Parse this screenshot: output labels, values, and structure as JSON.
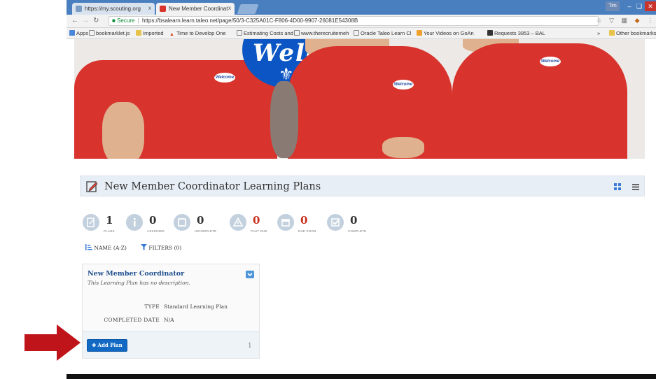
{
  "browser": {
    "tabs": [
      {
        "label": "https://my.scouting.org",
        "close": "x"
      },
      {
        "label": "New Member Coordinat",
        "close": "x"
      }
    ],
    "window_user": "Tim",
    "omnibox": {
      "secure_label": "Secure",
      "url": "https://bsalearn.learn.taleo.net/page/50/3-C325A01C-F806-4D00-9907-26081E54308B"
    },
    "bookmarks": [
      "Apps",
      "bookmarklet.js",
      "Imported",
      "Time to Develop One",
      "Estimating Costs and",
      "www.therecruiterneh",
      "Oracle Taleo Learn Cl",
      "Your Videos on GoAn",
      "Requests 3853 – BAL",
      "»",
      "Other bookmarks"
    ]
  },
  "hero": {
    "welcome_text": "Welco"
  },
  "page": {
    "title": "New Member Coordinator Learning Plans"
  },
  "stats": [
    {
      "value": "1",
      "label": "PLANS",
      "highlight": false
    },
    {
      "value": "0",
      "label": "ASSIGNED",
      "highlight": false
    },
    {
      "value": "0",
      "label": "INCOMPLETE",
      "highlight": false
    },
    {
      "value": "0",
      "label": "PAST DUE",
      "highlight": true
    },
    {
      "value": "0",
      "label": "DUE SOON",
      "highlight": true
    },
    {
      "value": "0",
      "label": "COMPLETE",
      "highlight": false
    }
  ],
  "sort": {
    "name_label": "NAME (A-Z)",
    "filters_label": "FILTERS (0)"
  },
  "card": {
    "title": "New Member Coordinator",
    "description": "This Learning Plan has no description.",
    "fields": [
      {
        "label": "TYPE",
        "value": "Standard Learning Plan"
      },
      {
        "label": "COMPLETED DATE",
        "value": "N/A"
      }
    ],
    "add_button_label": "Add Plan",
    "info_glyph": "i"
  },
  "colors": {
    "accent_blue": "#1169c4",
    "alert_red": "#c8311f",
    "arrow_red": "#c0141b",
    "title_bar_bg": "#e8eef5"
  }
}
